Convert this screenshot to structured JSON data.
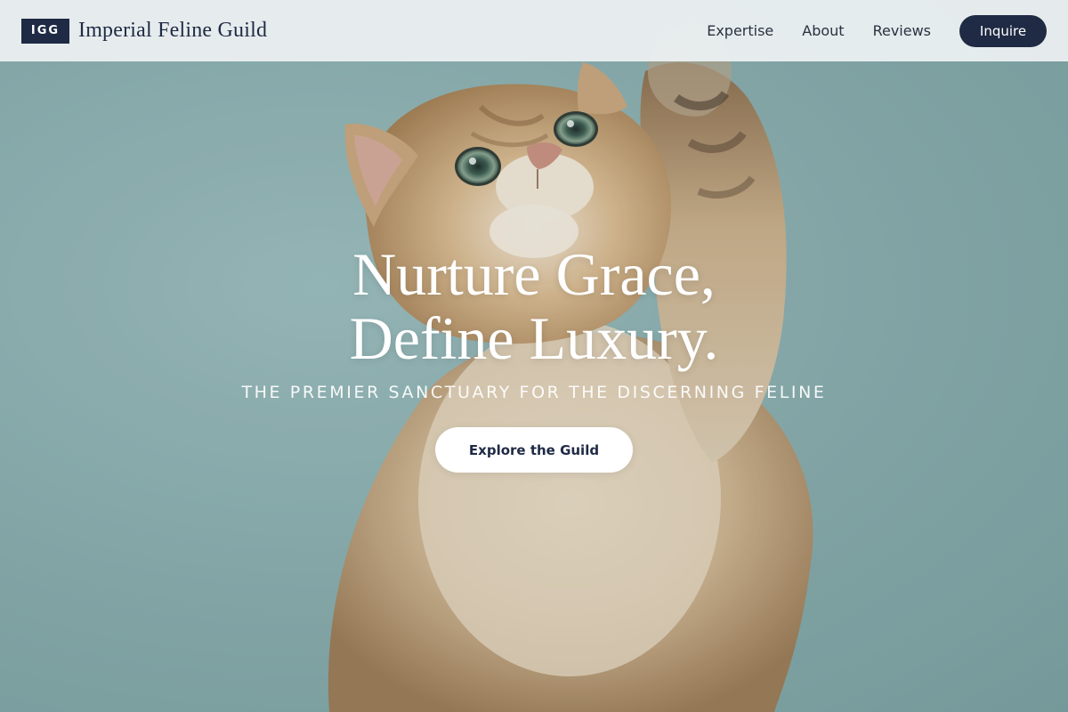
{
  "header": {
    "logo_mark": "IGG",
    "brand_name": "Imperial Feline Guild",
    "nav": [
      {
        "label": "Expertise"
      },
      {
        "label": "About"
      },
      {
        "label": "Reviews"
      }
    ],
    "inquire_label": "Inquire"
  },
  "hero": {
    "title_line1": "Nurture Grace,",
    "title_line2": "Define Luxury.",
    "subtitle": "THE PREMIER SANCTUARY FOR THE DISCERNING FELINE",
    "cta_label": "Explore the Guild",
    "background_image": "kitten-reaching-up-photo"
  },
  "colors": {
    "navy": "#1f2a44",
    "header_bg": "#ecf0f1",
    "hero_teal": "#8fb1b2",
    "white": "#ffffff"
  }
}
